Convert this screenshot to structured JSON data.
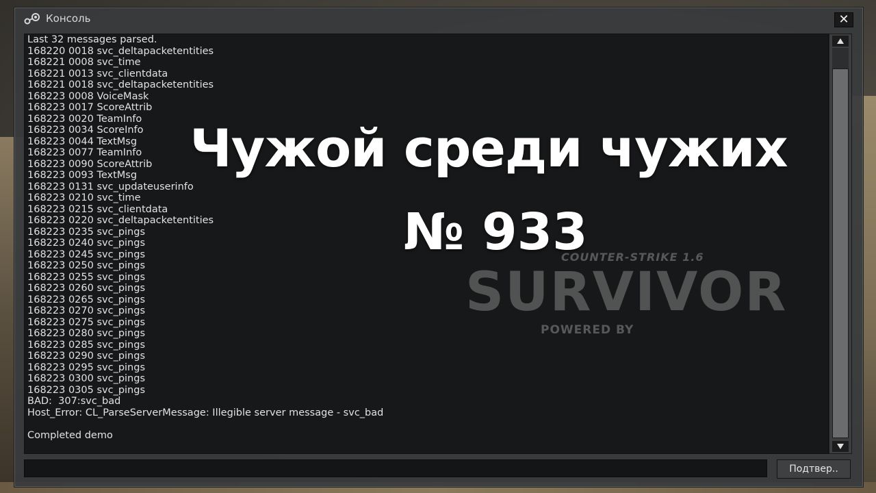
{
  "window": {
    "title": "Консоль",
    "close_label": "✕"
  },
  "console": {
    "lines": [
      "Last 32 messages parsed.",
      "168220 0018 svc_deltapacketentities",
      "168221 0008 svc_time",
      "168221 0013 svc_clientdata",
      "168221 0018 svc_deltapacketentities",
      "168223 0008 VoiceMask",
      "168223 0017 ScoreAttrib",
      "168223 0020 TeamInfo",
      "168223 0034 ScoreInfo",
      "168223 0044 TextMsg",
      "168223 0077 TeamInfo",
      "168223 0090 ScoreAttrib",
      "168223 0093 TextMsg",
      "168223 0131 svc_updateuserinfo",
      "168223 0210 svc_time",
      "168223 0215 svc_clientdata",
      "168223 0220 svc_deltapacketentities",
      "168223 0235 svc_pings",
      "168223 0240 svc_pings",
      "168223 0245 svc_pings",
      "168223 0250 svc_pings",
      "168223 0255 svc_pings",
      "168223 0260 svc_pings",
      "168223 0265 svc_pings",
      "168223 0270 svc_pings",
      "168223 0275 svc_pings",
      "168223 0280 svc_pings",
      "168223 0285 svc_pings",
      "168223 0290 svc_pings",
      "168223 0295 svc_pings",
      "168223 0300 svc_pings",
      "168223 0305 svc_pings",
      "BAD:  307:svc_bad",
      "Host_Error: CL_ParseServerMessage: Illegible server message - svc_bad",
      "",
      "Completed demo"
    ]
  },
  "scrollbar": {
    "up_icon": "scroll-up-arrow",
    "down_icon": "scroll-down-arrow",
    "position": 1.0
  },
  "input": {
    "value": "",
    "placeholder": ""
  },
  "submit_label": "Подтвер..",
  "background_logo": {
    "top": "COUNTER-STRIKE 1.6",
    "main": "SURVIVOR",
    "sub": "POWERED BY"
  },
  "overlay": {
    "line1": "Чужой среди чужих",
    "line2": "№ 933"
  },
  "colors": {
    "window_bg": "#383a3c",
    "console_bg": "#121314",
    "text": "#e2e2e2",
    "overlay_text": "#ffffff"
  }
}
